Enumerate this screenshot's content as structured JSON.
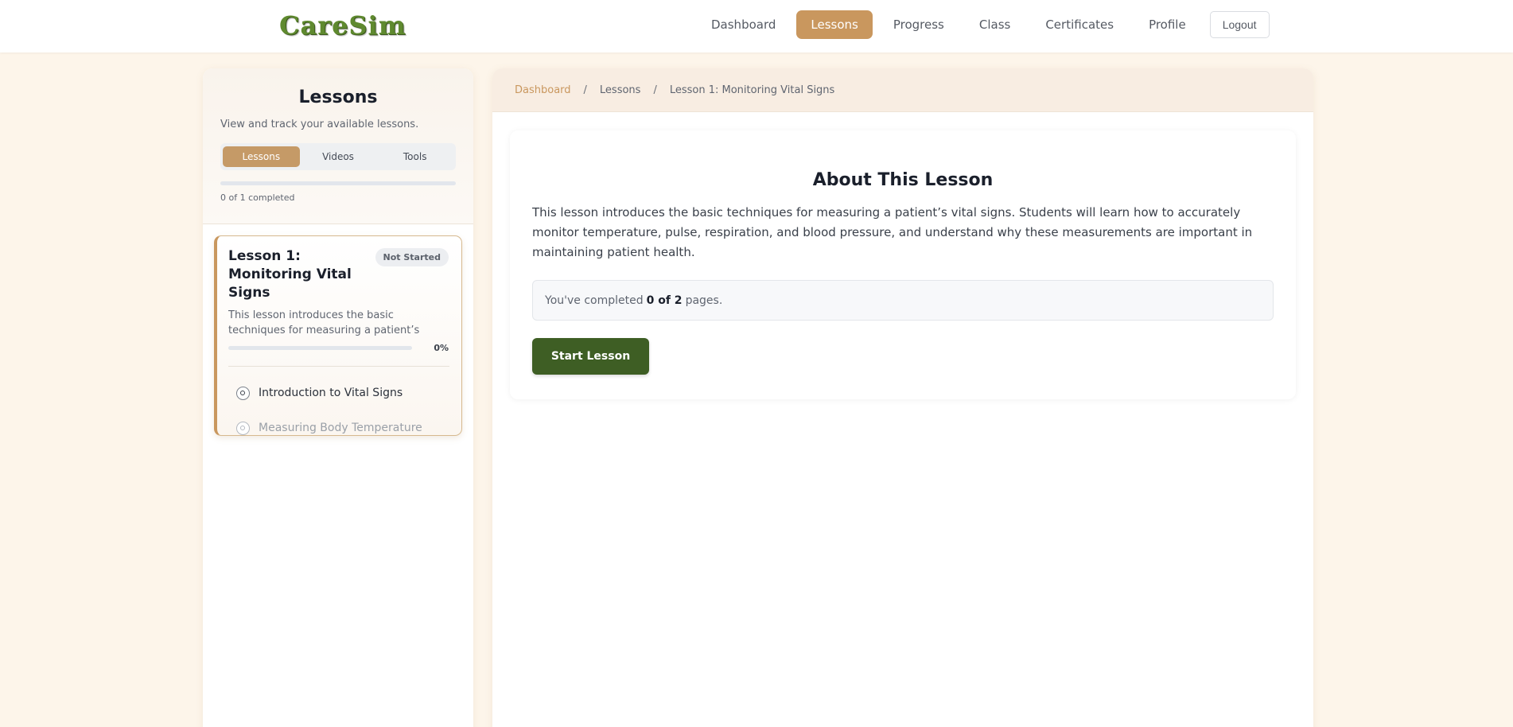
{
  "app": {
    "logo_text": "CareSim"
  },
  "nav": {
    "items": [
      {
        "label": "Dashboard",
        "active": false
      },
      {
        "label": "Lessons",
        "active": true
      },
      {
        "label": "Progress",
        "active": false
      },
      {
        "label": "Class",
        "active": false
      },
      {
        "label": "Certificates",
        "active": false
      },
      {
        "label": "Profile",
        "active": false
      }
    ],
    "logout_label": "Logout"
  },
  "sidebar": {
    "title": "Lessons",
    "subtitle": "View and track your available lessons.",
    "tabs": [
      {
        "label": "Lessons",
        "active": true
      },
      {
        "label": "Videos",
        "active": false
      },
      {
        "label": "Tools",
        "active": false
      }
    ],
    "overall_progress": 0,
    "progress_label": "0 of 1 completed",
    "lesson_card": {
      "title": "Lesson 1: Monitoring Vital Signs",
      "status_badge": "Not Started",
      "description": "This lesson introduces the basic techniques for measuring a patient’s vital…",
      "progress_percent": "0%",
      "progress_value": 0,
      "pages": [
        {
          "label": "Introduction to Vital Signs",
          "state": "current"
        },
        {
          "label": "Measuring Body Temperature",
          "state": "locked"
        }
      ]
    }
  },
  "breadcrumb": {
    "items": [
      "Dashboard",
      "Lessons",
      "Lesson 1: Monitoring Vital Signs"
    ],
    "separator": "/"
  },
  "main": {
    "title": "About This Lesson",
    "description": "This lesson introduces the basic techniques for measuring a patient’s vital signs. Students will learn how to accurately monitor temperature, pulse, respiration, and blood pressure, and understand why these measurements are important in maintaining patient health.",
    "completion": {
      "prefix": "You've completed",
      "count": "0 of 2",
      "suffix": "pages."
    },
    "start_button_label": "Start Lesson"
  },
  "colors": {
    "accent": "#c9975e",
    "primary_button": "#3e5e24",
    "background": "#fdf5ea"
  }
}
